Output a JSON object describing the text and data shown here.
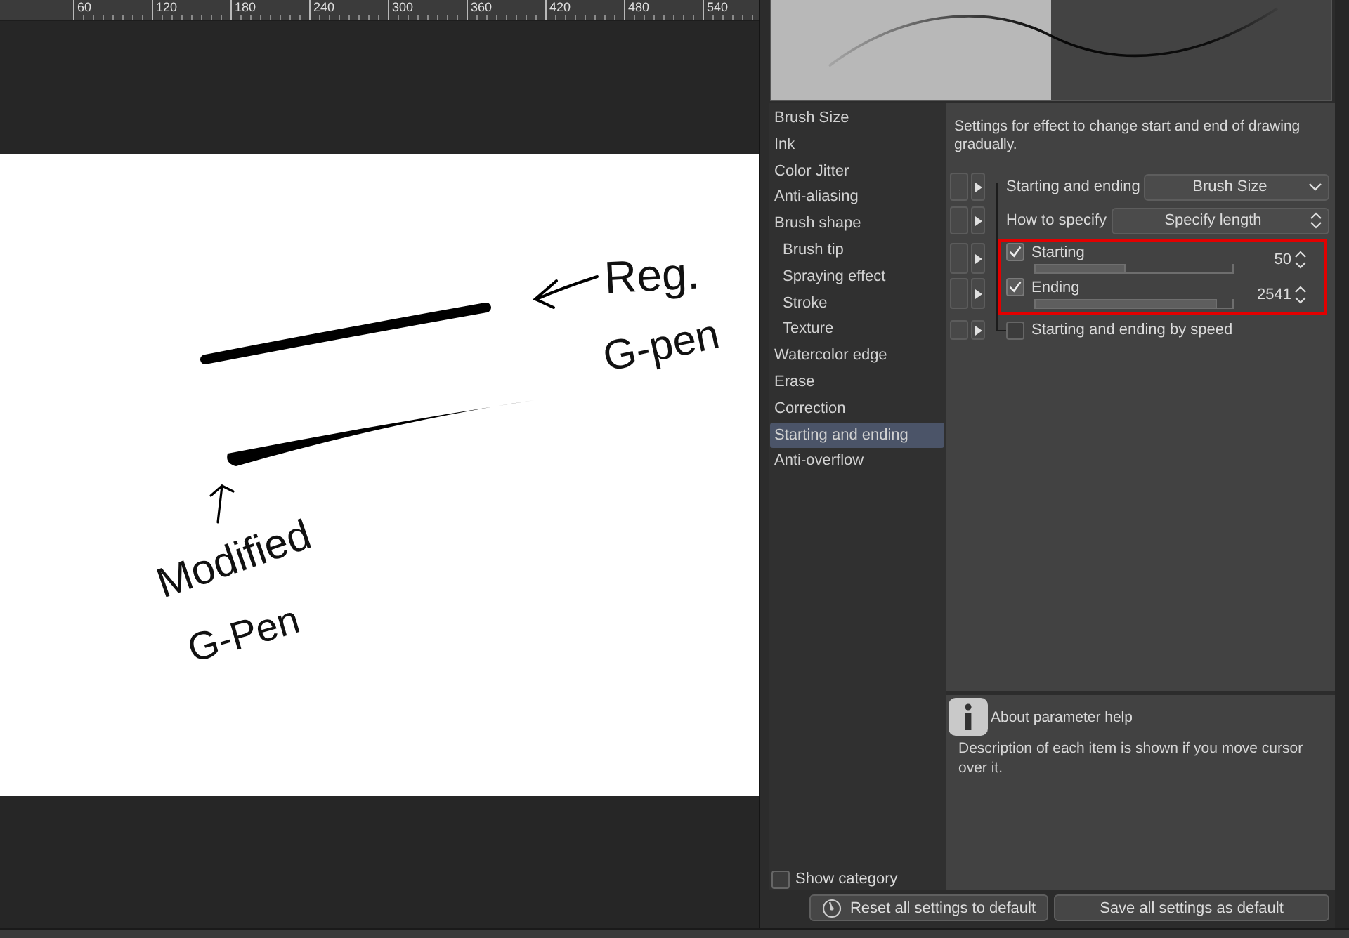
{
  "ruler": {
    "labels": [
      "60",
      "120",
      "180",
      "240",
      "300",
      "360",
      "420",
      "480",
      "540"
    ]
  },
  "canvas": {
    "notes": [
      {
        "text": "Reg."
      },
      {
        "text": "G-pen"
      },
      {
        "text": "Modified"
      },
      {
        "text": "G-Pen"
      }
    ]
  },
  "categories": [
    {
      "label": "Brush Size",
      "selected": false
    },
    {
      "label": "Ink",
      "selected": false
    },
    {
      "label": "Color Jitter",
      "selected": false
    },
    {
      "label": "Anti-aliasing",
      "selected": false
    },
    {
      "label": "Brush shape",
      "selected": false,
      "children": [
        {
          "label": "Brush tip",
          "selected": false
        },
        {
          "label": "Spraying effect",
          "selected": false
        },
        {
          "label": "Stroke",
          "selected": false
        },
        {
          "label": "Texture",
          "selected": false
        }
      ]
    },
    {
      "label": "Watercolor edge",
      "selected": false
    },
    {
      "label": "Erase",
      "selected": false
    },
    {
      "label": "Correction",
      "selected": false
    },
    {
      "label": "Starting and ending",
      "selected": true
    },
    {
      "label": "Anti-overflow",
      "selected": false
    }
  ],
  "description": "Settings for effect to change start and end of drawing gradually.",
  "settings": [
    {
      "kind": "dropdown",
      "label": "Starting and ending",
      "value": "Brush Size",
      "highlighted": false
    },
    {
      "kind": "select",
      "label": "How to specify",
      "value": "Specify length",
      "highlighted": false
    },
    {
      "kind": "slider",
      "label": "Starting",
      "checked": true,
      "level": 0.46,
      "reading": "50",
      "highlighted": true
    },
    {
      "kind": "slider",
      "label": "Ending",
      "checked": true,
      "level": 0.92,
      "reading": "2541",
      "highlighted": true
    },
    {
      "kind": "checkbox",
      "label": "Starting and ending by speed",
      "checked": false,
      "highlighted": false
    }
  ],
  "help": {
    "title": "About parameter help",
    "text": "Description of each item is shown if you move cursor over it."
  },
  "show_category": {
    "label": "Show category",
    "checked": false
  },
  "buttons": [
    {
      "label": "Reset all settings to default",
      "kind": "reset"
    },
    {
      "label": "Save all settings as default",
      "kind": "plain"
    }
  ]
}
